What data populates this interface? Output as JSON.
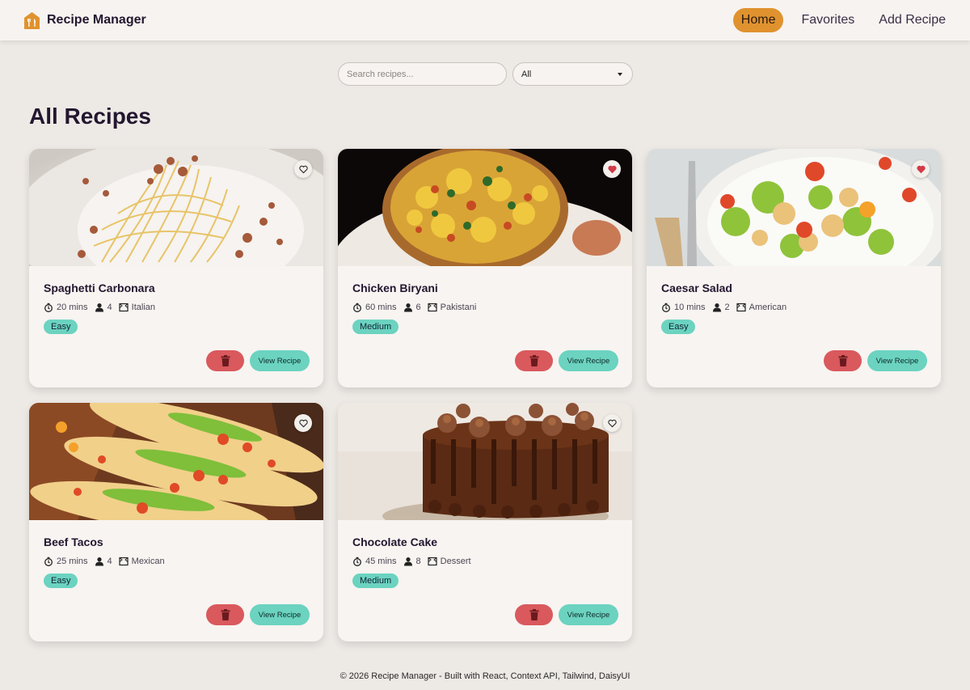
{
  "app": {
    "title": "Recipe Manager"
  },
  "nav": {
    "items": [
      {
        "label": "Home",
        "active": true
      },
      {
        "label": "Favorites",
        "active": false
      },
      {
        "label": "Add Recipe",
        "active": false
      }
    ]
  },
  "search": {
    "placeholder": "Search recipes...",
    "value": ""
  },
  "filter": {
    "selected": "All"
  },
  "page": {
    "title": "All Recipes"
  },
  "recipes": [
    {
      "name": "Spaghetti Carbonara",
      "time": "20 mins",
      "servings": "4",
      "cuisine": "Italian",
      "difficulty": "Easy",
      "favorite": false,
      "image": "spaghetti-carbonara-photo"
    },
    {
      "name": "Chicken Biryani",
      "time": "60 mins",
      "servings": "6",
      "cuisine": "Pakistani",
      "difficulty": "Medium",
      "favorite": true,
      "image": "chicken-biryani-photo"
    },
    {
      "name": "Caesar Salad",
      "time": "10 mins",
      "servings": "2",
      "cuisine": "American",
      "difficulty": "Easy",
      "favorite": true,
      "image": "caesar-salad-photo"
    },
    {
      "name": "Beef Tacos",
      "time": "25 mins",
      "servings": "4",
      "cuisine": "Mexican",
      "difficulty": "Easy",
      "favorite": false,
      "image": "beef-tacos-photo"
    },
    {
      "name": "Chocolate Cake",
      "time": "45 mins",
      "servings": "8",
      "cuisine": "Dessert",
      "difficulty": "Medium",
      "favorite": false,
      "image": "chocolate-cake-photo"
    }
  ],
  "buttons": {
    "view_label": "View Recipe"
  },
  "icons": {
    "time": "timer-icon",
    "servings": "chef-icon",
    "cuisine": "cuisine-flag-icon",
    "delete": "trash-icon",
    "favorite": "heart-icon",
    "brand": "house-fork-icon"
  },
  "colors": {
    "accent": "#e0922e",
    "teal": "#6bd3c0",
    "danger": "#d9595d",
    "heart": "#d23b47"
  },
  "footer": {
    "text": "© 2026 Recipe Manager - Built with React, Context API, Tailwind, DaisyUI"
  }
}
